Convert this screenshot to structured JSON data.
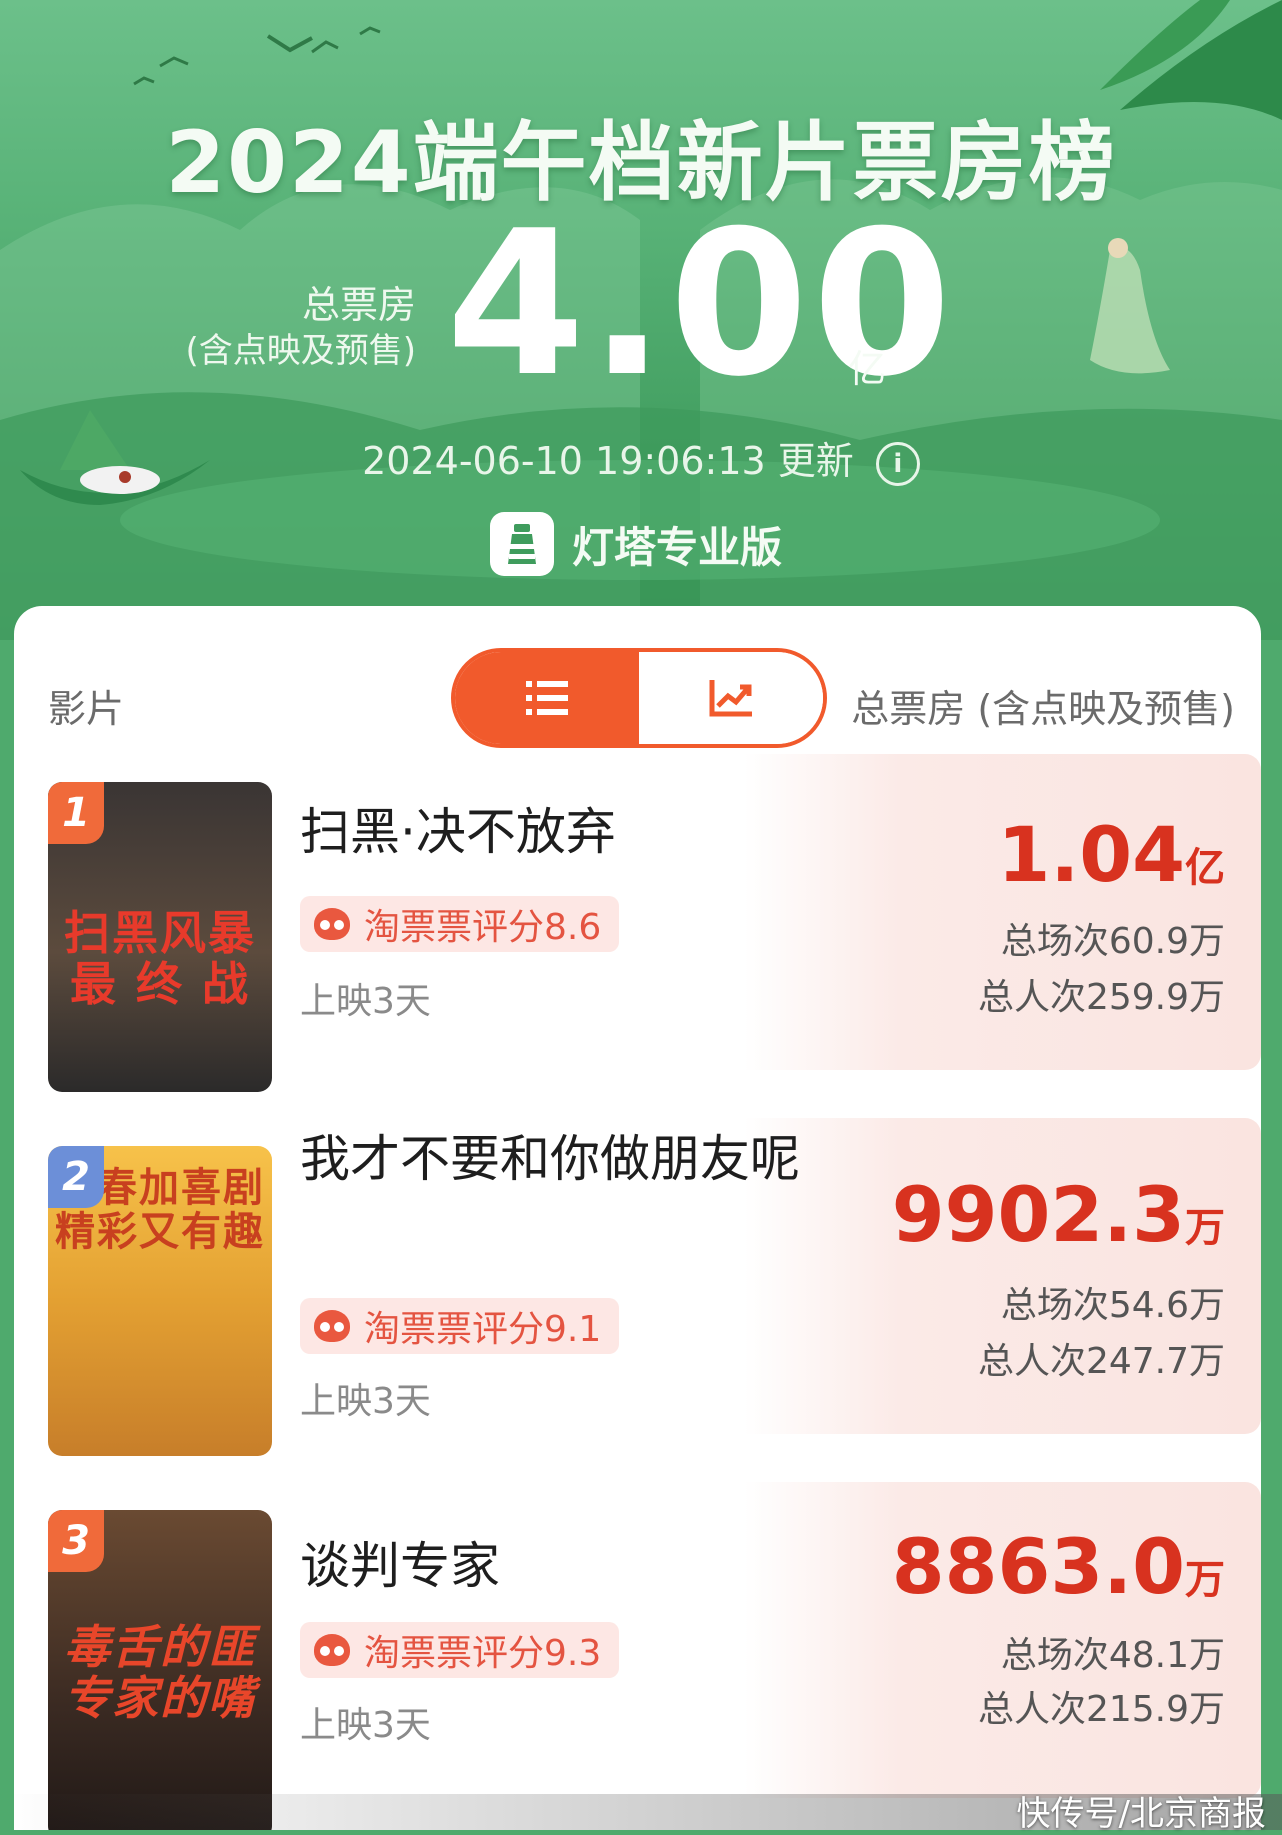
{
  "header": {
    "title": "2024端午档新片票房榜",
    "total_label_1": "总票房",
    "total_label_2": "(含点映及预售)",
    "total_value": "4.00",
    "total_unit": "亿",
    "update_time": "2024-06-10 19:06:13 更新",
    "info_icon": "i",
    "brand": "灯塔专业版"
  },
  "table": {
    "col_film": "影片",
    "col_total": "总票房 (含点映及预售)",
    "toggle": [
      "list-icon",
      "chart-icon"
    ],
    "active_toggle": "list"
  },
  "films": [
    {
      "rank": "1",
      "title": "扫黑·决不放弃",
      "rating": "淘票票评分8.6",
      "days": "上映3天",
      "gross_num": "1.04",
      "gross_unit": "亿",
      "shows": "总场次60.9万",
      "admissions": "总人次259.9万",
      "poster_text": "扫黑风暴\n最 终 战",
      "poster_colors": [
        "#2b2a2a",
        "#5c4b3d"
      ],
      "poster_text_color": "#e83a2b"
    },
    {
      "rank": "2",
      "title": "我才不要和你做朋友呢",
      "rating": "淘票票评分9.1",
      "days": "上映3天",
      "gross_num": "9902.3",
      "gross_unit": "万",
      "shows": "总场次54.6万",
      "admissions": "总人次247.7万",
      "poster_text": "青春加喜剧\n精彩又有趣",
      "poster_colors": [
        "#f5b93a",
        "#d98b2a"
      ],
      "poster_text_color": "#c8401f"
    },
    {
      "rank": "3",
      "title": "谈判专家",
      "rating": "淘票票评分9.3",
      "days": "上映3天",
      "gross_num": "8863.0",
      "gross_unit": "万",
      "shows": "总场次48.1万",
      "admissions": "总人次215.9万",
      "poster_text": "毒舌的匪\n专家的嘴",
      "poster_colors": [
        "#3a2a22",
        "#7a4a2c"
      ],
      "poster_text_color": "#e8462a"
    }
  ],
  "watermark": "快传号/北京商报",
  "colors": {
    "accent": "#f15a2c",
    "gross": "#d8321f",
    "hero_green": "#58b277"
  }
}
